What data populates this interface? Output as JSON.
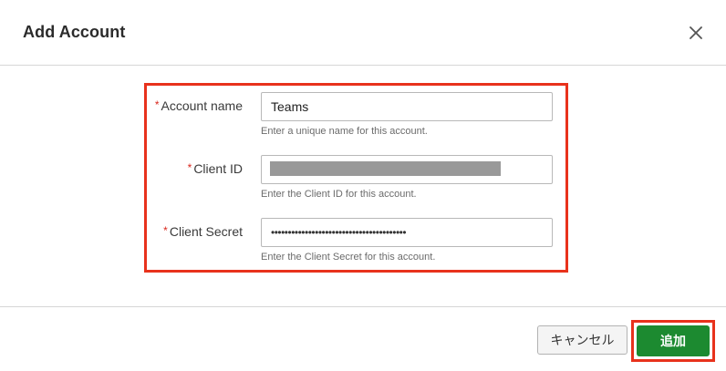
{
  "dialog": {
    "title": "Add Account",
    "close_icon": "close-icon"
  },
  "form": {
    "account_name": {
      "required_mark": "*",
      "label": "Account name",
      "value": "Teams",
      "help": "Enter a unique name for this account."
    },
    "client_id": {
      "required_mark": "*",
      "label": "Client ID",
      "value": "",
      "help": "Enter the Client ID for this account."
    },
    "client_secret": {
      "required_mark": "*",
      "label": "Client Secret",
      "value": "••••••••••••••••••••••••••••••••••••••••",
      "help": "Enter the Client Secret for this account."
    }
  },
  "footer": {
    "cancel_label": "キャンセル",
    "add_label": "追加"
  },
  "colors": {
    "highlight": "#e8321c",
    "primary": "#1c8a30",
    "required": "#d9261c"
  }
}
